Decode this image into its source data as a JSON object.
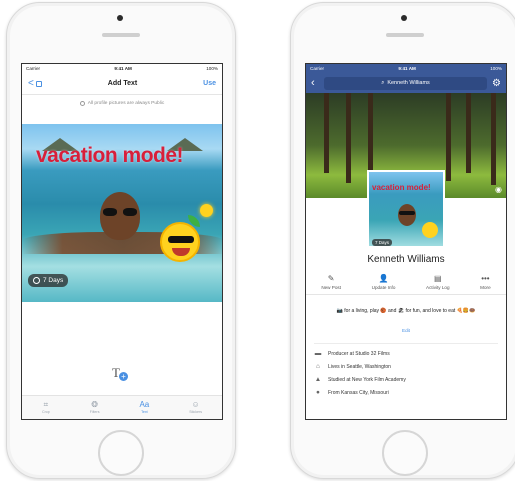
{
  "left_phone": {
    "status": {
      "carrier": "Carrier",
      "time": "9:41 AM",
      "battery": "100%"
    },
    "nav": {
      "back_label": "<",
      "title": "Add Text",
      "use_label": "Use"
    },
    "notice": "All profile pictures are always Public",
    "overlay_text": "vacation mode!",
    "duration_badge": "7 Days",
    "text_tool_glyph": "T",
    "tabs": [
      {
        "label": "Crop",
        "icon": "crop-icon",
        "glyph": "⌗"
      },
      {
        "label": "Filters",
        "icon": "filters-icon",
        "glyph": "❂"
      },
      {
        "label": "Text",
        "icon": "text-icon",
        "glyph": "Aa"
      },
      {
        "label": "Stickers",
        "icon": "stickers-icon",
        "glyph": "☺"
      }
    ]
  },
  "right_phone": {
    "status": {
      "carrier": "Carrier",
      "time": "9:41 AM",
      "battery": "100%"
    },
    "search_value": "Kenneth Williams",
    "profile_overlay_text": "vacation mode!",
    "profile_duration_badge": "7 Days",
    "name": "Kenneth Williams",
    "actions": [
      {
        "label": "New Post",
        "icon": "new-post-icon",
        "glyph": "✎"
      },
      {
        "label": "Update Info",
        "icon": "update-info-icon",
        "glyph": "👤"
      },
      {
        "label": "Activity Log",
        "icon": "activity-log-icon",
        "glyph": "▤"
      },
      {
        "label": "More",
        "icon": "more-icon",
        "glyph": "•••"
      }
    ],
    "bio": "📷 for a living, play 🏀 and 🏖 for fun, and love to eat 🍕🍔🍩",
    "edit_label": "Edit",
    "info": [
      {
        "text": "Producer at Studio 32 Films",
        "icon": "briefcase-icon",
        "glyph": "▬"
      },
      {
        "text": "Lives in Seattle, Washington",
        "icon": "home-icon",
        "glyph": "⌂"
      },
      {
        "text": "Studied at New York Film Academy",
        "icon": "graduation-icon",
        "glyph": "▲"
      },
      {
        "text": "From Kansas City, Missouri",
        "icon": "location-pin-icon",
        "glyph": "●"
      }
    ]
  },
  "colors": {
    "facebook_blue": "#3b5998",
    "accent_blue": "#4a90e2",
    "overlay_red": "#d81f3a"
  }
}
